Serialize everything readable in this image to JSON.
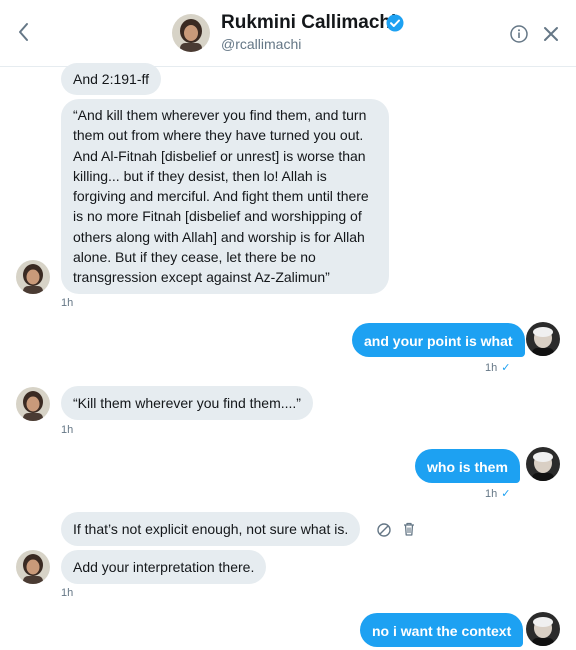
{
  "header": {
    "name": "Rukmini Callimachi",
    "handle": "@rcallimachi"
  },
  "messages": [
    {
      "text": "And 2:191-ff"
    },
    {
      "text": "“And kill them wherever you find them, and turn them out from where they have turned you out. And Al-Fitnah [disbelief or unrest] is worse than killing... but if they desist, then lo! Allah is forgiving and merciful. And fight them until there is no more Fitnah [disbelief and worshipping of others along with Allah] and worship is for Allah alone. But if they cease, let there be no transgression except against Az-Zalimun”",
      "time": "1h"
    },
    {
      "text": "and your point is what",
      "time": "1h"
    },
    {
      "text": "“Kill them wherever you find them....”",
      "time": "1h"
    },
    {
      "text": "who is them",
      "time": "1h"
    },
    {
      "text": "If that’s not explicit enough, not sure what is."
    },
    {
      "text": "Add your interpretation there.",
      "time": "1h"
    },
    {
      "text": "no i want the context"
    }
  ],
  "icons": {
    "back": "chevron-left-icon",
    "verified": "verified-badge-icon",
    "info": "info-icon",
    "close": "close-icon",
    "sent": "checkmark-icon",
    "unavailable": "block-icon",
    "delete": "trash-icon"
  },
  "colors": {
    "accent": "#1da1f2",
    "incoming_bubble": "#e6ecf0",
    "muted": "#657786"
  }
}
